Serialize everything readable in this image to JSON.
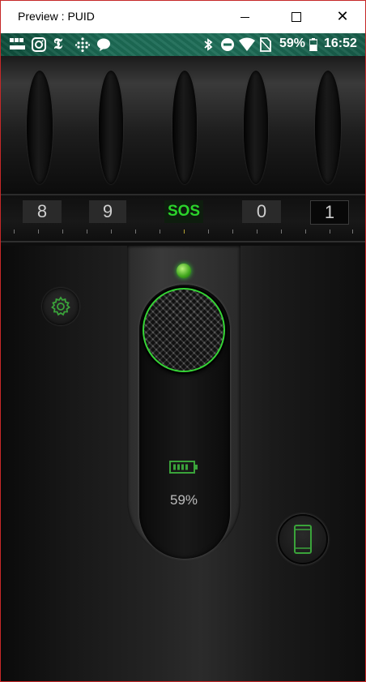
{
  "window": {
    "title": "Preview : PUID",
    "minimize_icon": "minimize-icon",
    "maximize_icon": "maximize-icon",
    "close_icon": "close-icon"
  },
  "status_bar": {
    "left_icons": [
      "bbc-news-icon",
      "instagram-icon",
      "nyt-icon",
      "dots-grid-icon",
      "chat-bubble-icon"
    ],
    "right_icons": [
      "bluetooth-icon",
      "do-not-disturb-icon",
      "wifi-icon",
      "no-sim-icon",
      "battery-icon"
    ],
    "battery_percent": "59%",
    "time": "16:52"
  },
  "mode_dial": {
    "items": [
      "8",
      "9",
      "SOS",
      "0",
      "1"
    ],
    "selected": "1"
  },
  "controls": {
    "battery_level": "59%",
    "settings_icon": "gear-icon",
    "screen_light_icon": "phone-icon",
    "accent_color": "#35d535"
  }
}
